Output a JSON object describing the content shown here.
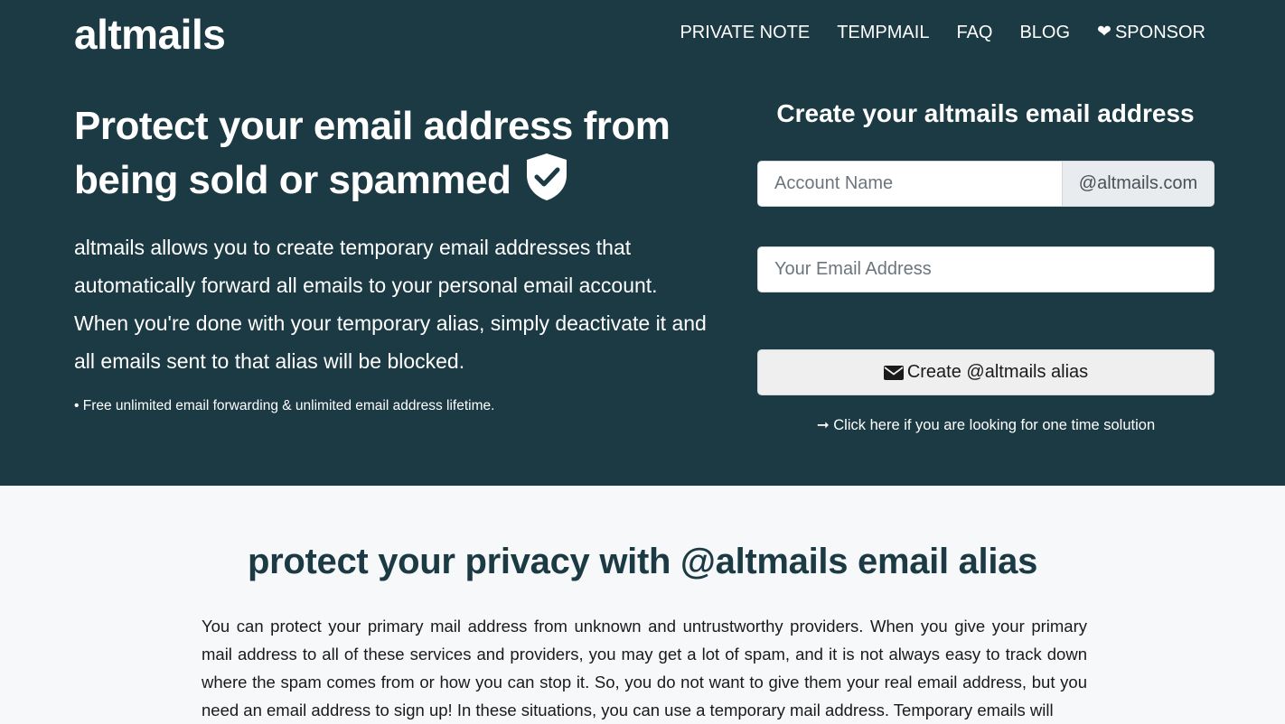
{
  "header": {
    "logo": "altmails",
    "nav": [
      {
        "label": "PRIVATE NOTE"
      },
      {
        "label": "TEMPMAIL"
      },
      {
        "label": "FAQ"
      },
      {
        "label": "BLOG"
      },
      {
        "label": "SPONSOR",
        "icon": "heart-icon"
      }
    ]
  },
  "hero": {
    "headline": "Protect your email address from being sold or spammed",
    "headline_icon": "shield-check-icon",
    "lead": "altmails allows you to create temporary email addresses that automatically forward all emails to your personal email account. When you're done with your temporary alias, simply deactivate it and all emails sent to that alias will be blocked.",
    "bullet": "• Free unlimited email forwarding & unlimited email address lifetime."
  },
  "form": {
    "title": "Create your altmails email address",
    "account_placeholder": "Account Name",
    "domain_suffix": "@altmails.com",
    "email_placeholder": "Your Email Address",
    "button_label": "Create @altmails alias",
    "button_icon": "envelope-icon",
    "onetime_link": "➞ Click here if you are looking for one time solution"
  },
  "section": {
    "title": "protect your privacy with @altmails email alias",
    "body": "You can protect your primary mail address from unknown and untrustworthy providers. When you give your primary mail address to all of these services and providers, you may get a lot of spam, and it is not always easy to track down where the spam comes from or how you can stop it. So, you do not want to give them your real email address, but you need an email address to sign up! In these situations, you can use a temporary mail address. Temporary emails will"
  },
  "colors": {
    "hero_bg": "#1b3a44",
    "page_bg": "#f7f8fa",
    "button_bg": "#efefef"
  }
}
